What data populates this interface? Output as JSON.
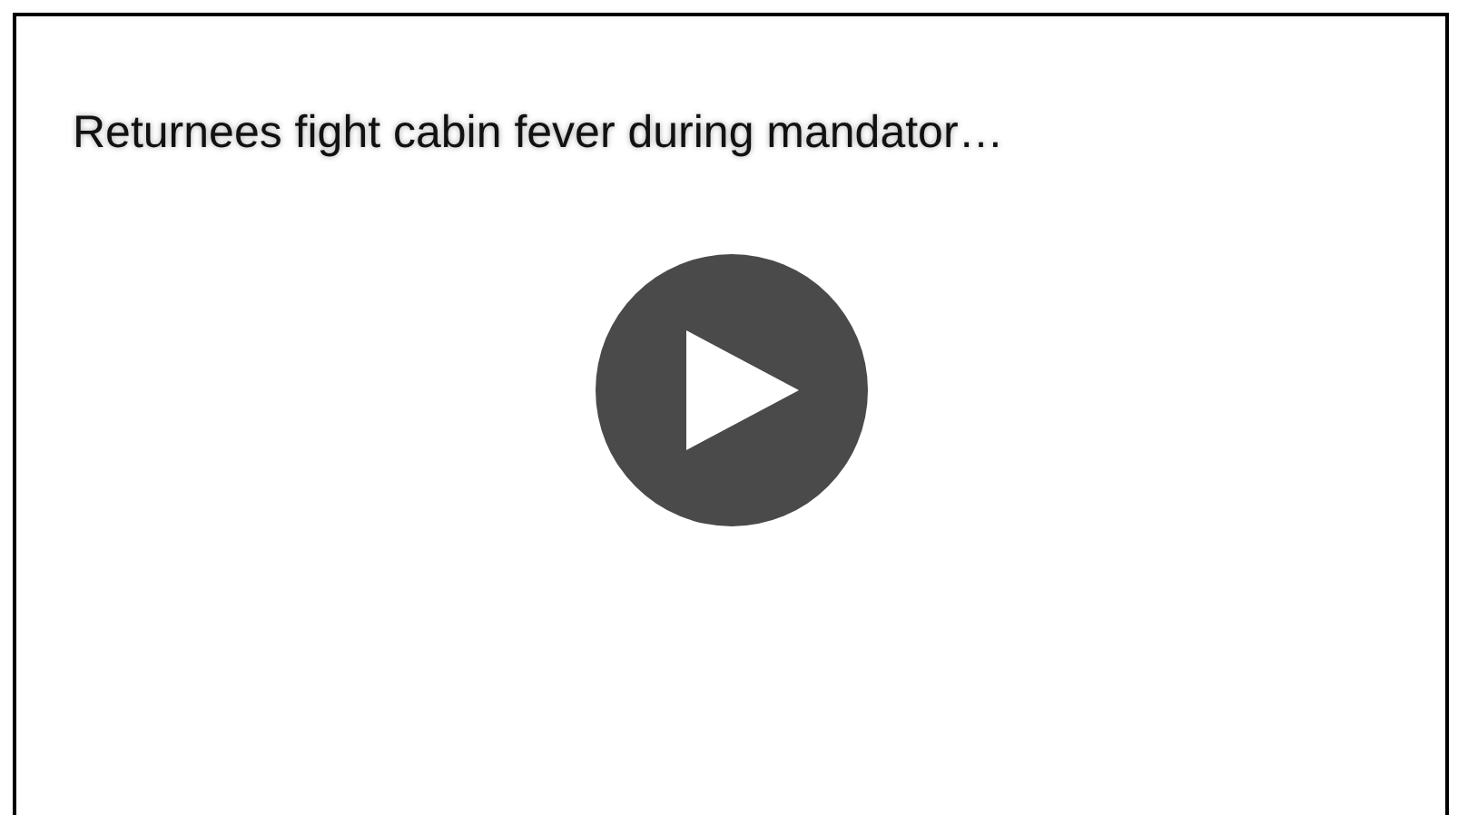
{
  "video": {
    "title": "Returnees fight cabin fever during mandator…"
  }
}
